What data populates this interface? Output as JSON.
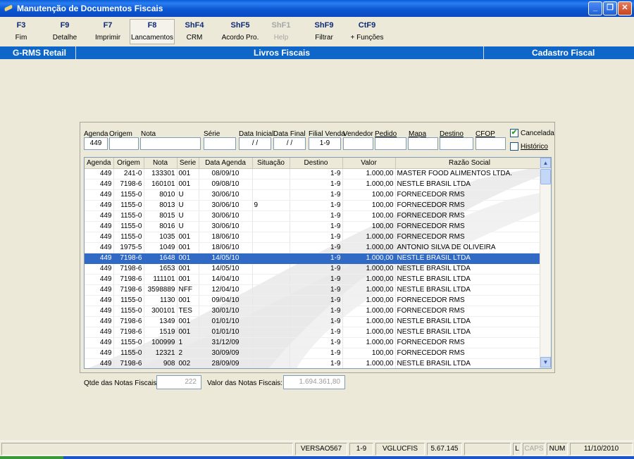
{
  "window": {
    "title": "Manutenção de Documentos Fiscais"
  },
  "toolbar": {
    "keys": [
      {
        "key": "F3",
        "label": "Fim"
      },
      {
        "key": "F9",
        "label": "Detalhe"
      },
      {
        "key": "F7",
        "label": "Imprimir"
      },
      {
        "key": "F8",
        "label": "Lancamentos"
      },
      {
        "key": "ShF4",
        "label": "CRM"
      },
      {
        "key": "ShF5",
        "label": "Acordo Pro."
      },
      {
        "key": "ShF1",
        "label": "Help"
      },
      {
        "key": "ShF9",
        "label": "Filtrar"
      },
      {
        "key": "CtF9",
        "label": "+ Funções"
      }
    ]
  },
  "header": {
    "left": "G-RMS Retail",
    "center": "Livros Fiscais",
    "right": "Cadastro Fiscal"
  },
  "filter": {
    "labels": {
      "agenda": "Agenda",
      "origem": "Origem",
      "nota": "Nota",
      "serie": "Série",
      "data_inicial": "Data Inicial",
      "data_final": "Data Final",
      "filial_venda": "Filial Venda",
      "vendedor": "Vendedor",
      "pedido": "Pedido",
      "mapa": "Mapa",
      "destino": "Destino",
      "cfop": "CFOP"
    },
    "values": {
      "agenda": "449",
      "origem": "",
      "nota": "",
      "serie": "",
      "data_inicial": "/ /",
      "data_final": "/ /",
      "filial_venda": "1-9",
      "vendedor": "",
      "pedido": "",
      "mapa": "",
      "destino": "",
      "cfop": ""
    },
    "cancelada_label": "Cancelada",
    "historico_label": "Histórico"
  },
  "grid": {
    "columns": [
      "Agenda",
      "Origem",
      "Nota",
      "Serie",
      "Data Agenda",
      "Situação",
      "Destino",
      "Valor",
      "Razão Social",
      "*"
    ],
    "rows": [
      [
        "449",
        "241-0",
        "133301",
        "001",
        "08/09/10",
        "",
        "1-9",
        "1.000,00",
        "MASTER FOOD ALIMENTOS LTDA."
      ],
      [
        "449",
        "7198-6",
        "160101",
        "001",
        "09/08/10",
        "",
        "1-9",
        "1.000,00",
        "NESTLE BRASIL LTDA"
      ],
      [
        "449",
        "1155-0",
        "8010",
        "U",
        "30/06/10",
        "",
        "1-9",
        "100,00",
        "FORNECEDOR RMS"
      ],
      [
        "449",
        "1155-0",
        "8013",
        "U",
        "30/06/10",
        "9",
        "1-9",
        "100,00",
        "FORNECEDOR RMS"
      ],
      [
        "449",
        "1155-0",
        "8015",
        "U",
        "30/06/10",
        "",
        "1-9",
        "100,00",
        "FORNECEDOR RMS"
      ],
      [
        "449",
        "1155-0",
        "8016",
        "U",
        "30/06/10",
        "",
        "1-9",
        "100,00",
        "FORNECEDOR RMS"
      ],
      [
        "449",
        "1155-0",
        "1035",
        "001",
        "18/06/10",
        "",
        "1-9",
        "1.000,00",
        "FORNECEDOR RMS"
      ],
      [
        "449",
        "1975-5",
        "1049",
        "001",
        "18/06/10",
        "",
        "1-9",
        "1.000,00",
        "ANTONIO SILVA DE OLIVEIRA"
      ],
      [
        "449",
        "7198-6",
        "1648",
        "001",
        "14/05/10",
        "",
        "1-9",
        "1.000,00",
        "NESTLE BRASIL LTDA"
      ],
      [
        "449",
        "7198-6",
        "1653",
        "001",
        "14/05/10",
        "",
        "1-9",
        "1.000,00",
        "NESTLE BRASIL LTDA"
      ],
      [
        "449",
        "7198-6",
        "111101",
        "001",
        "14/04/10",
        "",
        "1-9",
        "1.000,00",
        "NESTLE BRASIL LTDA"
      ],
      [
        "449",
        "7198-6",
        "3598889",
        "NFF",
        "12/04/10",
        "",
        "1-9",
        "1.000,00",
        "NESTLE BRASIL LTDA"
      ],
      [
        "449",
        "1155-0",
        "1130",
        "001",
        "09/04/10",
        "",
        "1-9",
        "1.000,00",
        "FORNECEDOR RMS"
      ],
      [
        "449",
        "1155-0",
        "300101",
        "TES",
        "30/01/10",
        "",
        "1-9",
        "1.000,00",
        "FORNECEDOR RMS"
      ],
      [
        "449",
        "7198-6",
        "1349",
        "001",
        "01/01/10",
        "",
        "1-9",
        "1.000,00",
        "NESTLE BRASIL LTDA"
      ],
      [
        "449",
        "7198-6",
        "1519",
        "001",
        "01/01/10",
        "",
        "1-9",
        "1.000,00",
        "NESTLE BRASIL LTDA"
      ],
      [
        "449",
        "1155-0",
        "100999",
        "1",
        "31/12/09",
        "",
        "1-9",
        "1.000,00",
        "FORNECEDOR RMS"
      ],
      [
        "449",
        "1155-0",
        "12321",
        "2",
        "30/09/09",
        "",
        "1-9",
        "100,00",
        "FORNECEDOR RMS"
      ],
      [
        "449",
        "7198-6",
        "908",
        "002",
        "28/09/09",
        "",
        "1-9",
        "1.000,00",
        "NESTLE BRASIL LTDA"
      ]
    ],
    "selected_row": 8
  },
  "totals": {
    "qtde_label": "Qtde das Notas Fiscais:",
    "qtde_value": "222",
    "valor_label": "Valor  das Notas Fiscais:",
    "valor_value": "1.694.361,80"
  },
  "statusbar": {
    "version": "VERSAO567",
    "filial": "1-9",
    "program": "VGLUCFIS",
    "build": "5.67.145",
    "l": "L",
    "caps": "CAPS",
    "num": "NUM",
    "date": "11/10/2010"
  },
  "colors": {
    "titlebar": "#0c58d3",
    "band": "#0e66c8",
    "selection": "#316ac5",
    "key_text": "#0b2a7a"
  }
}
